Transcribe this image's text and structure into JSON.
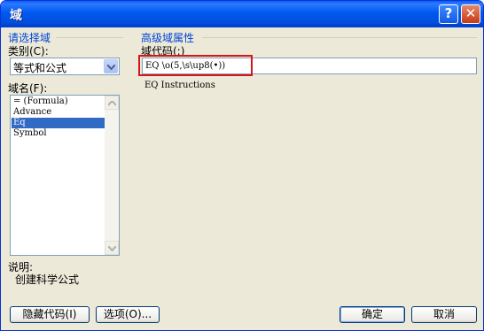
{
  "window": {
    "title": "域"
  },
  "left_panel": {
    "group_title": "请选择域",
    "category_label": "类别(C):",
    "category_value": "等式和公式",
    "field_names_label": "域名(F):",
    "field_names": [
      {
        "label": "= (Formula)",
        "selected": false
      },
      {
        "label": "Advance",
        "selected": false
      },
      {
        "label": "Eq",
        "selected": true
      },
      {
        "label": "Symbol",
        "selected": false
      }
    ],
    "description_label": "说明:",
    "description_text": "创建科学公式"
  },
  "right_panel": {
    "group_title": "高级域属性",
    "field_code_label": "域代码(:)",
    "field_code_value": "EQ \\o(5,\\s\\up8(•))",
    "instructions_label": "EQ Instructions"
  },
  "buttons": {
    "hide_codes": "隐藏代码(I)",
    "options": "选项(O)...",
    "ok": "确定",
    "cancel": "取消"
  },
  "colors": {
    "titlebar": "#0058ee",
    "group_title": "#0046d5",
    "selection": "#316ac5",
    "highlight_box": "#d61518"
  }
}
